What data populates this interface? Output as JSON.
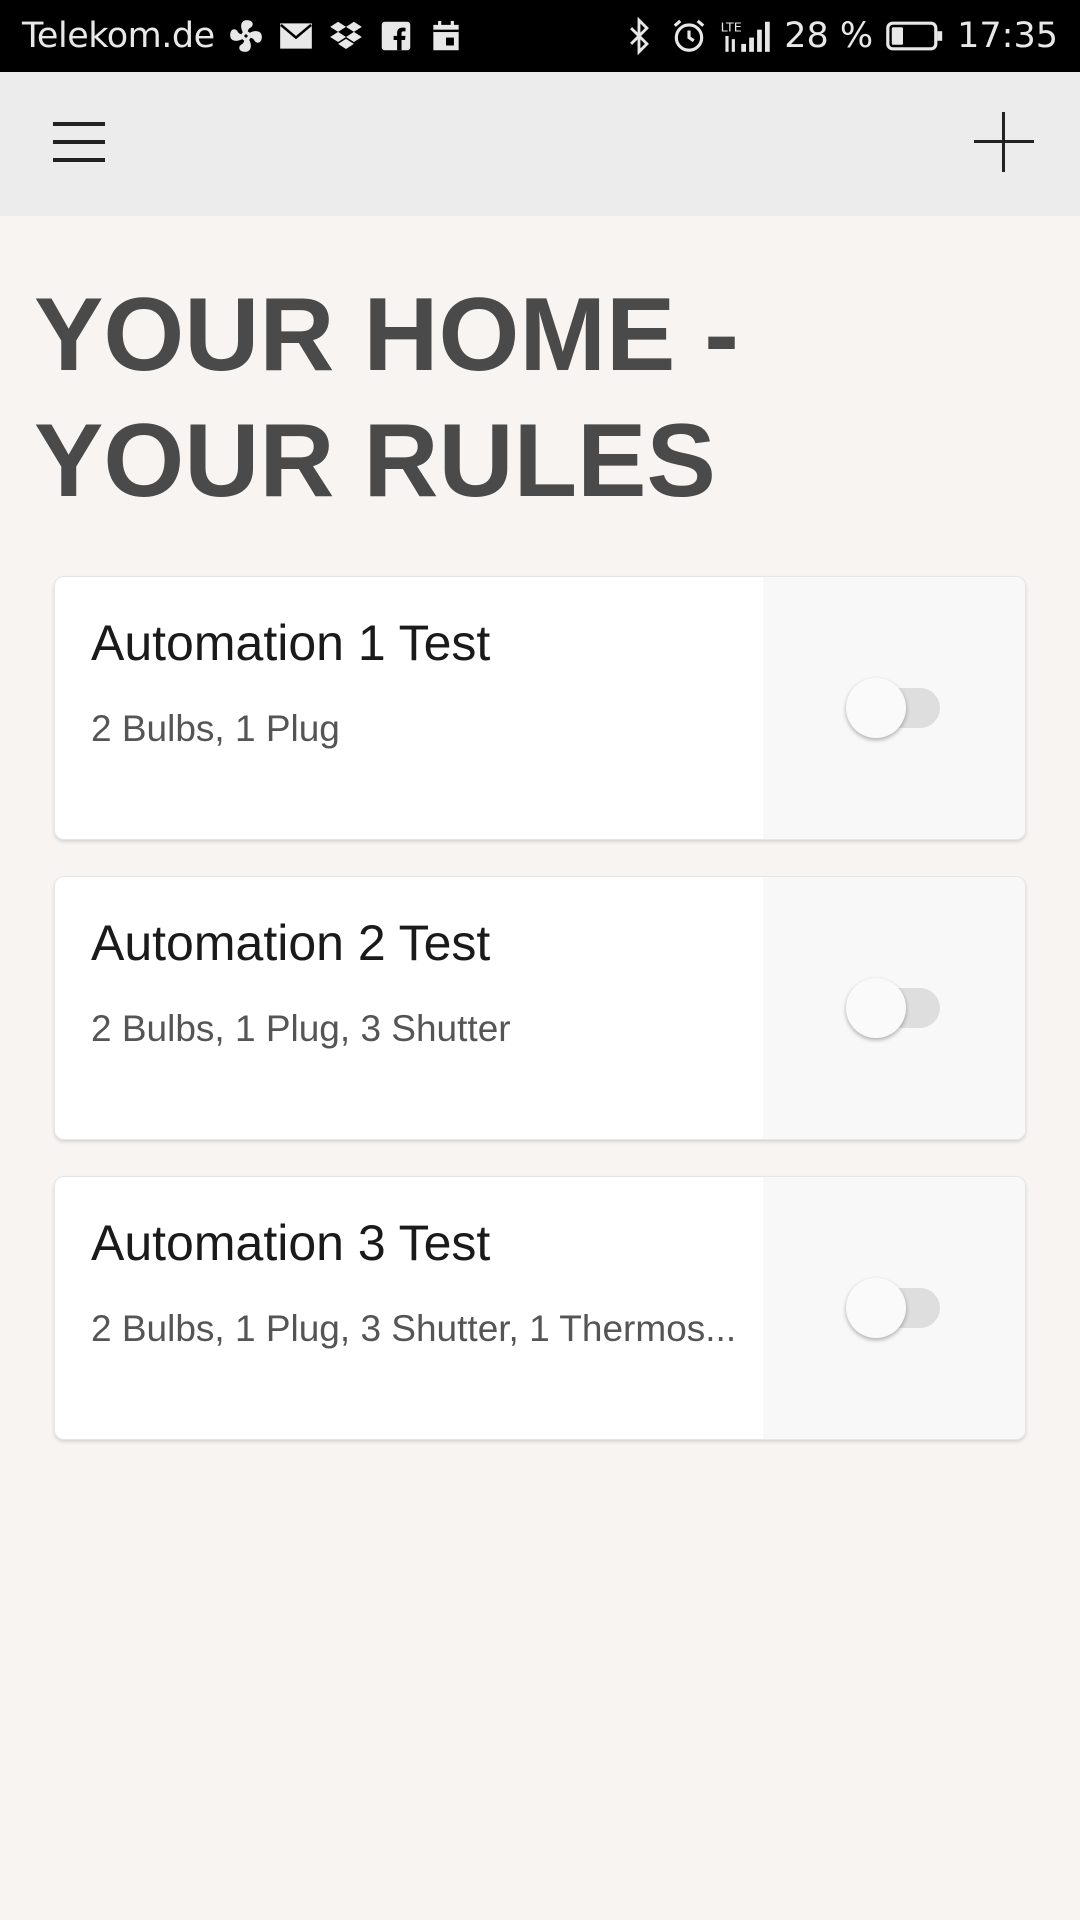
{
  "status_bar": {
    "carrier": "Telekom.de",
    "icons_left": [
      "fan-icon",
      "mail-icon",
      "dropbox-icon",
      "facebook-icon",
      "calendar-icon"
    ],
    "icons_right": [
      "bluetooth-icon",
      "alarm-icon",
      "lte-signal-icon"
    ],
    "battery_percent": "28 %",
    "battery_level": 0.28,
    "time": "17:35"
  },
  "app_bar": {
    "menu_icon": "hamburger-menu-icon",
    "add_icon": "plus-icon"
  },
  "page": {
    "title": "YOUR HOME - YOUR RULES"
  },
  "automations": [
    {
      "name": "Automation 1 Test",
      "devices": "2 Bulbs, 1 Plug",
      "enabled": false
    },
    {
      "name": "Automation 2 Test",
      "devices": "2 Bulbs, 1 Plug, 3 Shutter",
      "enabled": false
    },
    {
      "name": "Automation 3 Test",
      "devices": "2 Bulbs, 1 Plug, 3 Shutter, 1 Thermos...",
      "enabled": false
    }
  ],
  "colors": {
    "background": "#f7f4f1",
    "app_bar": "#ececec",
    "title_text": "#4a4a4a",
    "toggle_off_track": "#dedede"
  }
}
